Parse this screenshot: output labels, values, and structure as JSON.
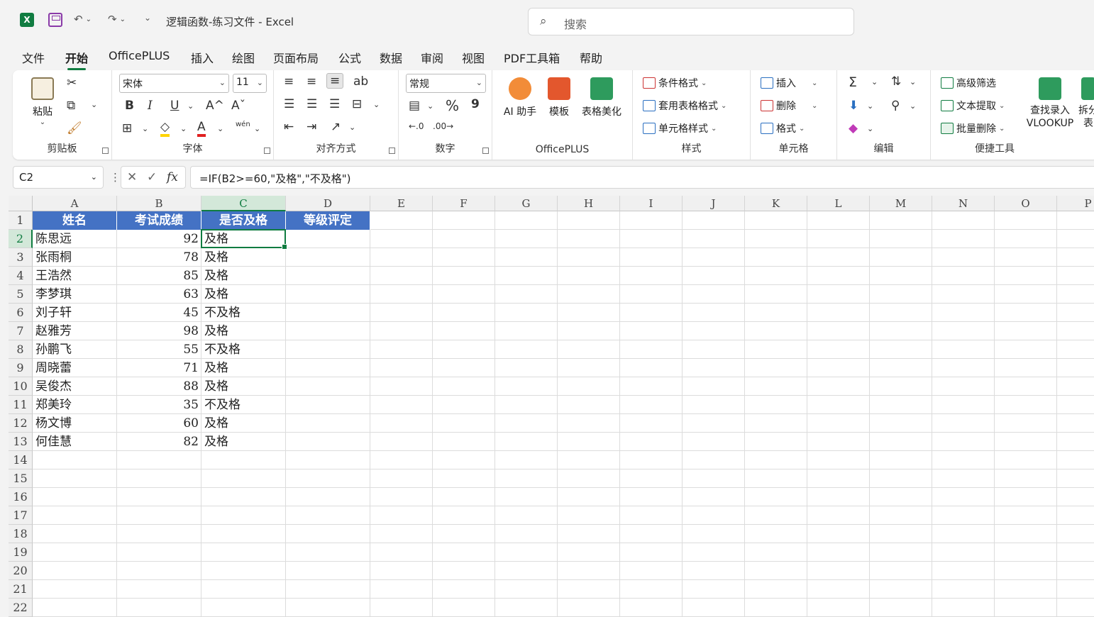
{
  "window": {
    "title": "逻辑函数-练习文件 - Excel",
    "logo": "X"
  },
  "search": {
    "placeholder": "搜索"
  },
  "tabs": [
    "文件",
    "开始",
    "OfficePLUS",
    "插入",
    "绘图",
    "页面布局",
    "公式",
    "数据",
    "审阅",
    "视图",
    "PDF工具箱",
    "帮助"
  ],
  "active_tab": "开始",
  "ribbon": {
    "clipboard": {
      "label": "剪贴板",
      "paste": "粘贴"
    },
    "font": {
      "label": "字体",
      "name": "宋体",
      "size": "11",
      "bold": "B",
      "italic": "I",
      "underline": "U",
      "grow": "A^",
      "shrink": "Aˇ",
      "phonetic": "wén"
    },
    "alignment": {
      "label": "对齐方式"
    },
    "number": {
      "label": "数字",
      "format": "常规",
      "percent": "%",
      "comma": "9"
    },
    "officeplus": {
      "label": "OfficePLUS",
      "ai": "AI 助手",
      "template": "模板",
      "beautify": "表格美化"
    },
    "styles": {
      "label": "样式",
      "conditional": "条件格式",
      "table_format": "套用表格格式",
      "cell_style": "单元格样式"
    },
    "cells": {
      "label": "单元格",
      "insert": "插入",
      "delete": "删除",
      "format": "格式"
    },
    "editing": {
      "label": "编辑",
      "sum": "Σ"
    },
    "tools": {
      "label": "便捷工具",
      "advanced_filter": "高级筛选",
      "text_extract": "文本提取",
      "batch_delete": "批量删除",
      "lookup": "查找录入",
      "vlookup": "VLOOKUP",
      "split": "拆分",
      "split2": "表"
    }
  },
  "formula_bar": {
    "name_box": "C2",
    "formula": "=IF(B2>=60,\"及格\",\"不及格\")",
    "fx": "fx"
  },
  "columns": [
    "A",
    "B",
    "C",
    "D",
    "E",
    "F",
    "G",
    "H",
    "I",
    "J",
    "K",
    "L",
    "M",
    "N",
    "O",
    "P"
  ],
  "rows": [
    "1",
    "2",
    "3",
    "4",
    "5",
    "6",
    "7",
    "8",
    "9",
    "10",
    "11",
    "12",
    "13",
    "14",
    "15",
    "16",
    "17",
    "18",
    "19",
    "20",
    "21",
    "22"
  ],
  "selected": {
    "column": "C",
    "row": "2"
  },
  "headers": [
    "姓名",
    "考试成绩",
    "是否及格",
    "等级评定"
  ],
  "data": [
    {
      "name": "陈思远",
      "score": "92",
      "pass": "及格"
    },
    {
      "name": "张雨桐",
      "score": "78",
      "pass": "及格"
    },
    {
      "name": "王浩然",
      "score": "85",
      "pass": "及格"
    },
    {
      "name": "李梦琪",
      "score": "63",
      "pass": "及格"
    },
    {
      "name": "刘子轩",
      "score": "45",
      "pass": "不及格"
    },
    {
      "name": "赵雅芳",
      "score": "98",
      "pass": "及格"
    },
    {
      "name": "孙鹏飞",
      "score": "55",
      "pass": "不及格"
    },
    {
      "name": "周晓蕾",
      "score": "71",
      "pass": "及格"
    },
    {
      "name": "吴俊杰",
      "score": "88",
      "pass": "及格"
    },
    {
      "name": "郑美玲",
      "score": "35",
      "pass": "不及格"
    },
    {
      "name": "杨文博",
      "score": "60",
      "pass": "及格"
    },
    {
      "name": "何佳慧",
      "score": "82",
      "pass": "及格"
    }
  ],
  "colors": {
    "accent": "#107c41",
    "header_fill": "#4472c4"
  }
}
